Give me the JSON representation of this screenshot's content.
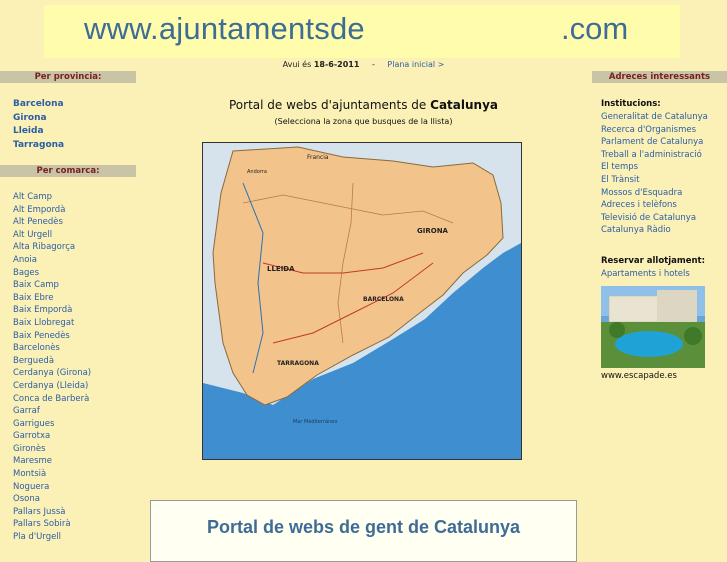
{
  "header": {
    "domain_left": "www.ajuntamentsde",
    "domain_right": ".com"
  },
  "dateline": {
    "prefix": "Avui és",
    "date": "18-6-2011",
    "separator": "-",
    "home_link": "Plana inicial >"
  },
  "left": {
    "province_header": "Per provincia:",
    "provinces": [
      "Barcelona",
      "Girona",
      "Lleida",
      "Tarragona"
    ],
    "comarca_header": "Per comarca:",
    "comarcas": [
      "Alt Camp",
      "Alt Empordà",
      "Alt Penedès",
      "Alt Urgell",
      "Alta Ribagorça",
      "Anoia",
      "Bages",
      "Baix Camp",
      "Baix Ebre",
      "Baix Empordà",
      "Baix Llobregat",
      "Baix Penedès",
      "Barcelonès",
      "Berguedà",
      "Cerdanya (Girona)",
      "Cerdanya (Lleida)",
      "Conca de Barberà",
      "Garraf",
      "Garrigues",
      "Garrotxa",
      "Gironès",
      "Maresme",
      "Montsià",
      "Noguera",
      "Osona",
      "Pallars Jussà",
      "Pallars Sobirà",
      "Pla d'Urgell"
    ]
  },
  "center": {
    "title_prefix": "Portal de webs d'ajuntaments de",
    "title_bold": "Catalunya",
    "subtitle": "(Selecciona la zona que busques de la llista)",
    "map": {
      "labels": [
        "Francia",
        "Andorra",
        "LLEIDA",
        "GIRONA",
        "BARCELONA",
        "TARRAGONA",
        "Mar Mediterráneo"
      ]
    },
    "box_title": "Portal de webs de gent de Catalunya"
  },
  "right": {
    "header": "Adreces interessants",
    "institutions_header": "Institucions:",
    "institutions": [
      "Generalitat de Catalunya",
      "Recerca d'Organismes",
      "Parlament de Catalunya",
      "Treball a l'administració",
      "El temps",
      "El Trànsit",
      "Mossos d'Esquadra",
      "Adreces i telèfons",
      "Televisió de Catalunya",
      "Catalunya Ràdio"
    ],
    "lodging_header": "Reservar allotjament:",
    "lodging_link": "Apartaments i hotels",
    "photo_caption": "www.escapade.es"
  },
  "colors": {
    "page_bg": "#fbf0b6",
    "banner_bg": "#fffdab",
    "link": "#2b5ea5",
    "section_header_bg": "#c9c4a6",
    "section_header_text": "#7b2020",
    "title_blue": "#3e6c97",
    "sea": "#3f8fd0",
    "land": "#f2c48b"
  }
}
